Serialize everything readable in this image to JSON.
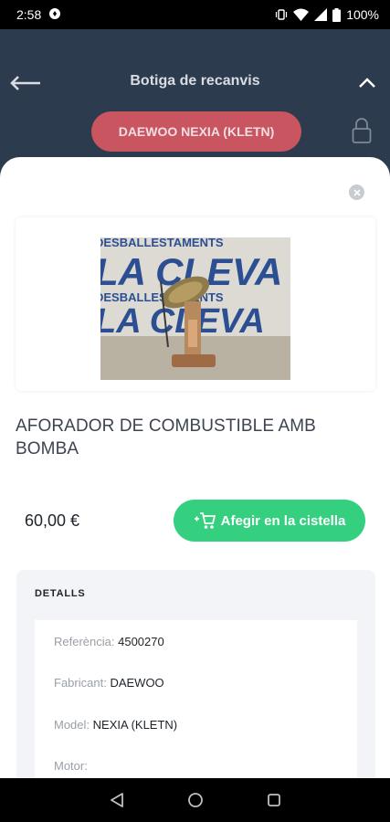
{
  "status_bar": {
    "time": "2:58",
    "battery": "100%"
  },
  "header": {
    "title": "Botiga de recanvis",
    "vehicle": "DAEWOO NEXIA (KLETN)"
  },
  "product": {
    "name": "AFORADOR DE COMBUSTIBLE AMB BOMBA",
    "price": "60,00 €",
    "add_to_cart_label": "Afegir en la cistella",
    "photo_text_line1": "DESBALLESTAMENTS",
    "photo_text_line2": "LA CLEVA"
  },
  "details": {
    "title": "DETALLS",
    "rows": [
      {
        "label": "Referència:",
        "value": "4500270"
      },
      {
        "label": "Fabricant:",
        "value": "DAEWOO"
      },
      {
        "label": "Model:",
        "value": "NEXIA (KLETN)"
      },
      {
        "label": "Motor:",
        "value": ""
      }
    ]
  },
  "colors": {
    "header_bg": "#2d3b4e",
    "vehicle_pill": "#c95561",
    "cart_button": "#35d07f"
  },
  "icons": [
    "back-arrow-icon",
    "chevron-up-icon",
    "lock-icon",
    "close-icon",
    "cart-icon",
    "nav-back-icon",
    "nav-home-icon",
    "nav-recents-icon"
  ]
}
